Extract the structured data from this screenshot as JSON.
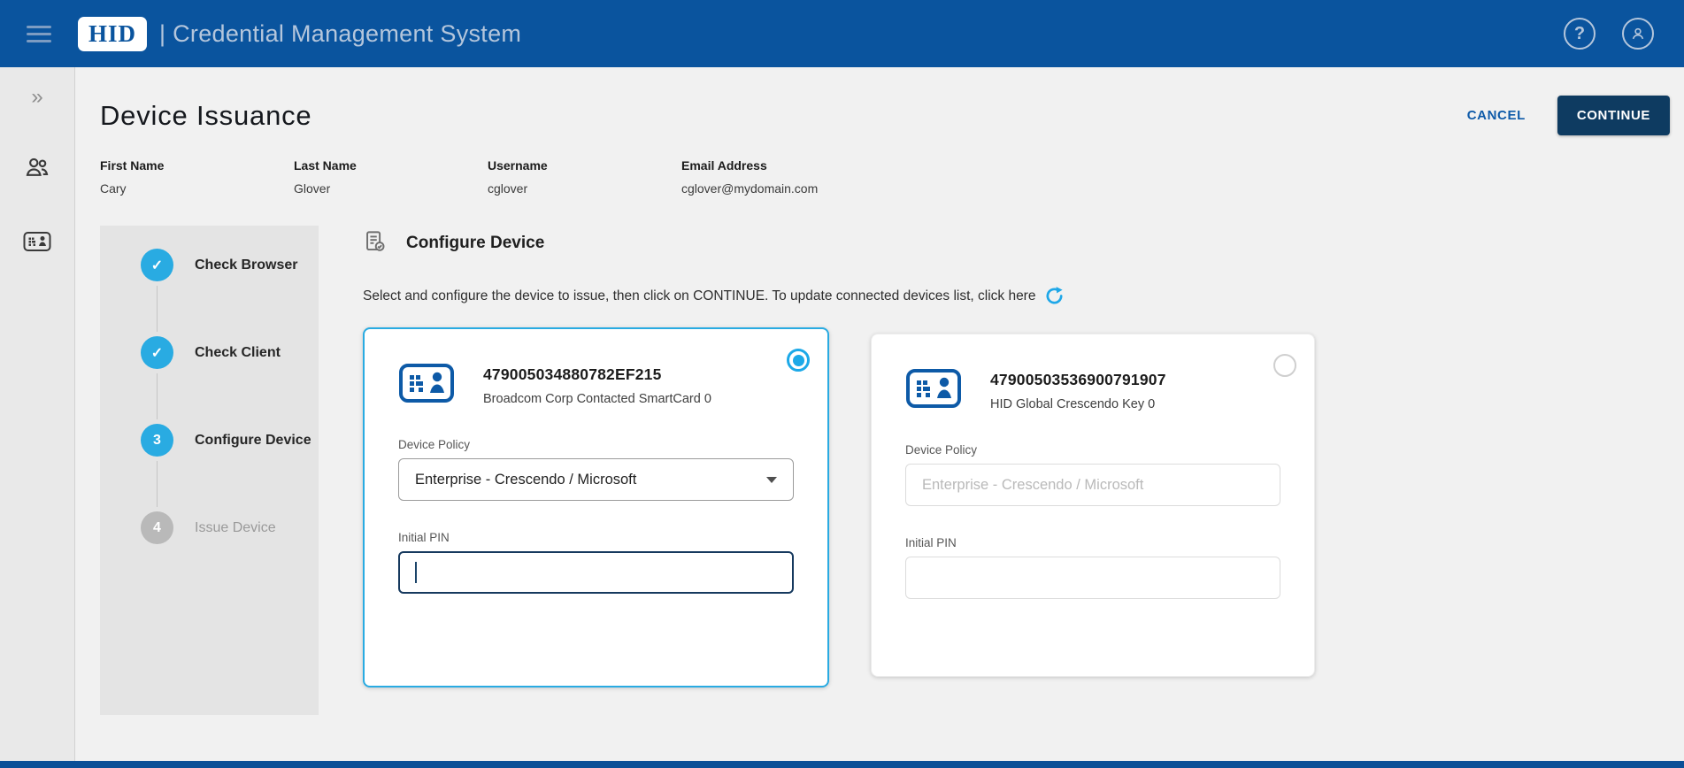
{
  "header": {
    "brand": "HID",
    "app_title": "| Credential Management System"
  },
  "page": {
    "title": "Device Issuance",
    "cancel_label": "CANCEL",
    "continue_label": "CONTINUE"
  },
  "user": {
    "first_name_label": "First Name",
    "first_name": "Cary",
    "last_name_label": "Last Name",
    "last_name": "Glover",
    "username_label": "Username",
    "username": "cglover",
    "email_label": "Email Address",
    "email": "cglover@mydomain.com"
  },
  "stepper": {
    "steps": [
      {
        "label": "Check Browser",
        "marker": "✓",
        "state": "done"
      },
      {
        "label": "Check Client",
        "marker": "✓",
        "state": "done"
      },
      {
        "label": "Configure Device",
        "marker": "3",
        "state": "active"
      },
      {
        "label": "Issue Device",
        "marker": "4",
        "state": "pending"
      }
    ]
  },
  "section": {
    "title": "Configure Device",
    "instruction": "Select and configure the device to issue, then click on CONTINUE. To update connected devices list, click here"
  },
  "devices": [
    {
      "serial": "479005034880782EF215",
      "name": "Broadcom Corp Contacted SmartCard 0",
      "policy_label": "Device Policy",
      "policy_value": "Enterprise - Crescendo / Microsoft",
      "pin_label": "Initial PIN",
      "pin_value": "",
      "selected": true
    },
    {
      "serial": "47900503536900791907",
      "name": "HID Global Crescendo Key 0",
      "policy_label": "Device Policy",
      "policy_value": "Enterprise - Crescendo / Microsoft",
      "pin_label": "Initial PIN",
      "pin_value": "",
      "selected": false
    }
  ],
  "colors": {
    "header_blue": "#0a549e",
    "accent_cyan": "#29abe2",
    "continue_navy": "#0e3b61",
    "cancel_blue": "#0f5ba9",
    "device_icon_blue": "#0d5aa7",
    "focus_border_navy": "#16395e",
    "bottom_strip_blue": "#0a4f97"
  }
}
